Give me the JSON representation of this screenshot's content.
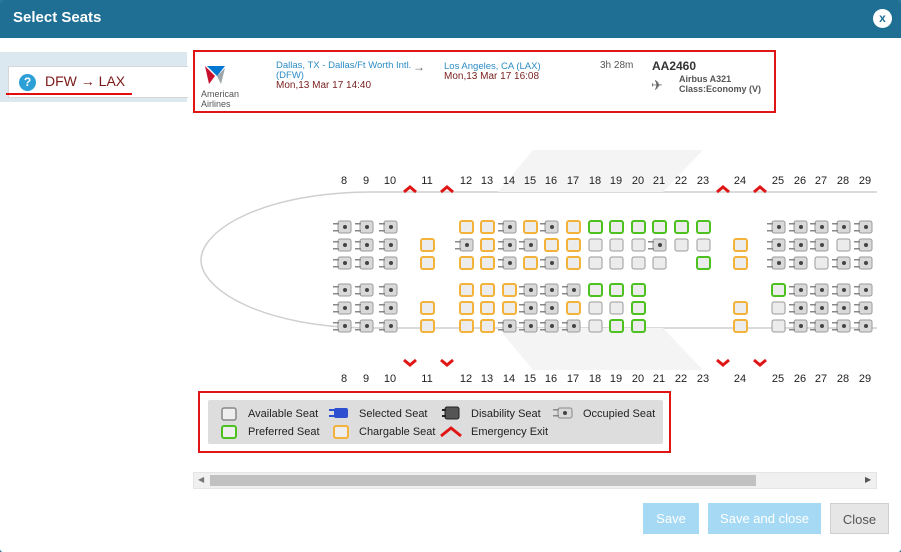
{
  "dialog": {
    "title": "Select Seats",
    "close_label": "x"
  },
  "route_tab": {
    "label": "DFW → LAX",
    "help_glyph": "?"
  },
  "flight": {
    "airline": "American Airlines",
    "departure_city": "Dallas, TX - Dallas/Ft Worth Intl. (DFW)",
    "departure_time": "Mon,13 Mar 17 14:40",
    "arrow": "→",
    "arrival_city": "Los Angeles, CA (LAX)",
    "arrival_time": "Mon,13 Mar 17 16:08",
    "duration": "3h 28m",
    "flight_number": "AA2460",
    "aircraft": "Airbus A321",
    "cabin_class": "Class:Economy (V)"
  },
  "seat_map": {
    "row_numbers": [
      "8",
      "9",
      "10",
      "11",
      "12",
      "13",
      "14",
      "15",
      "16",
      "17",
      "18",
      "19",
      "20",
      "21",
      "22",
      "23",
      "24",
      "25",
      "26",
      "27",
      "28",
      "29"
    ],
    "exit_rows": [
      "10",
      "11",
      "23",
      "24"
    ],
    "seat_colors": {
      "available": "#d9d9d9",
      "preferred": "#4cc11f",
      "chargeable": "#f3b23a",
      "occupied": "#d9d9d9",
      "selected": "#2f4fd1"
    }
  },
  "legend": {
    "available": "Available Seat",
    "selected": "Selected Seat",
    "disability": "Disability Seat",
    "occupied": "Occupied Seat",
    "preferred": "Preferred Seat",
    "chargable": "Chargable Seat",
    "exit": "Emergency Exit"
  },
  "buttons": {
    "save": "Save",
    "save_close": "Save and close",
    "close": "Close"
  },
  "scrollbar": {
    "left_glyph": "◀",
    "right_glyph": "▶"
  },
  "icons": {
    "plane": "✈"
  }
}
